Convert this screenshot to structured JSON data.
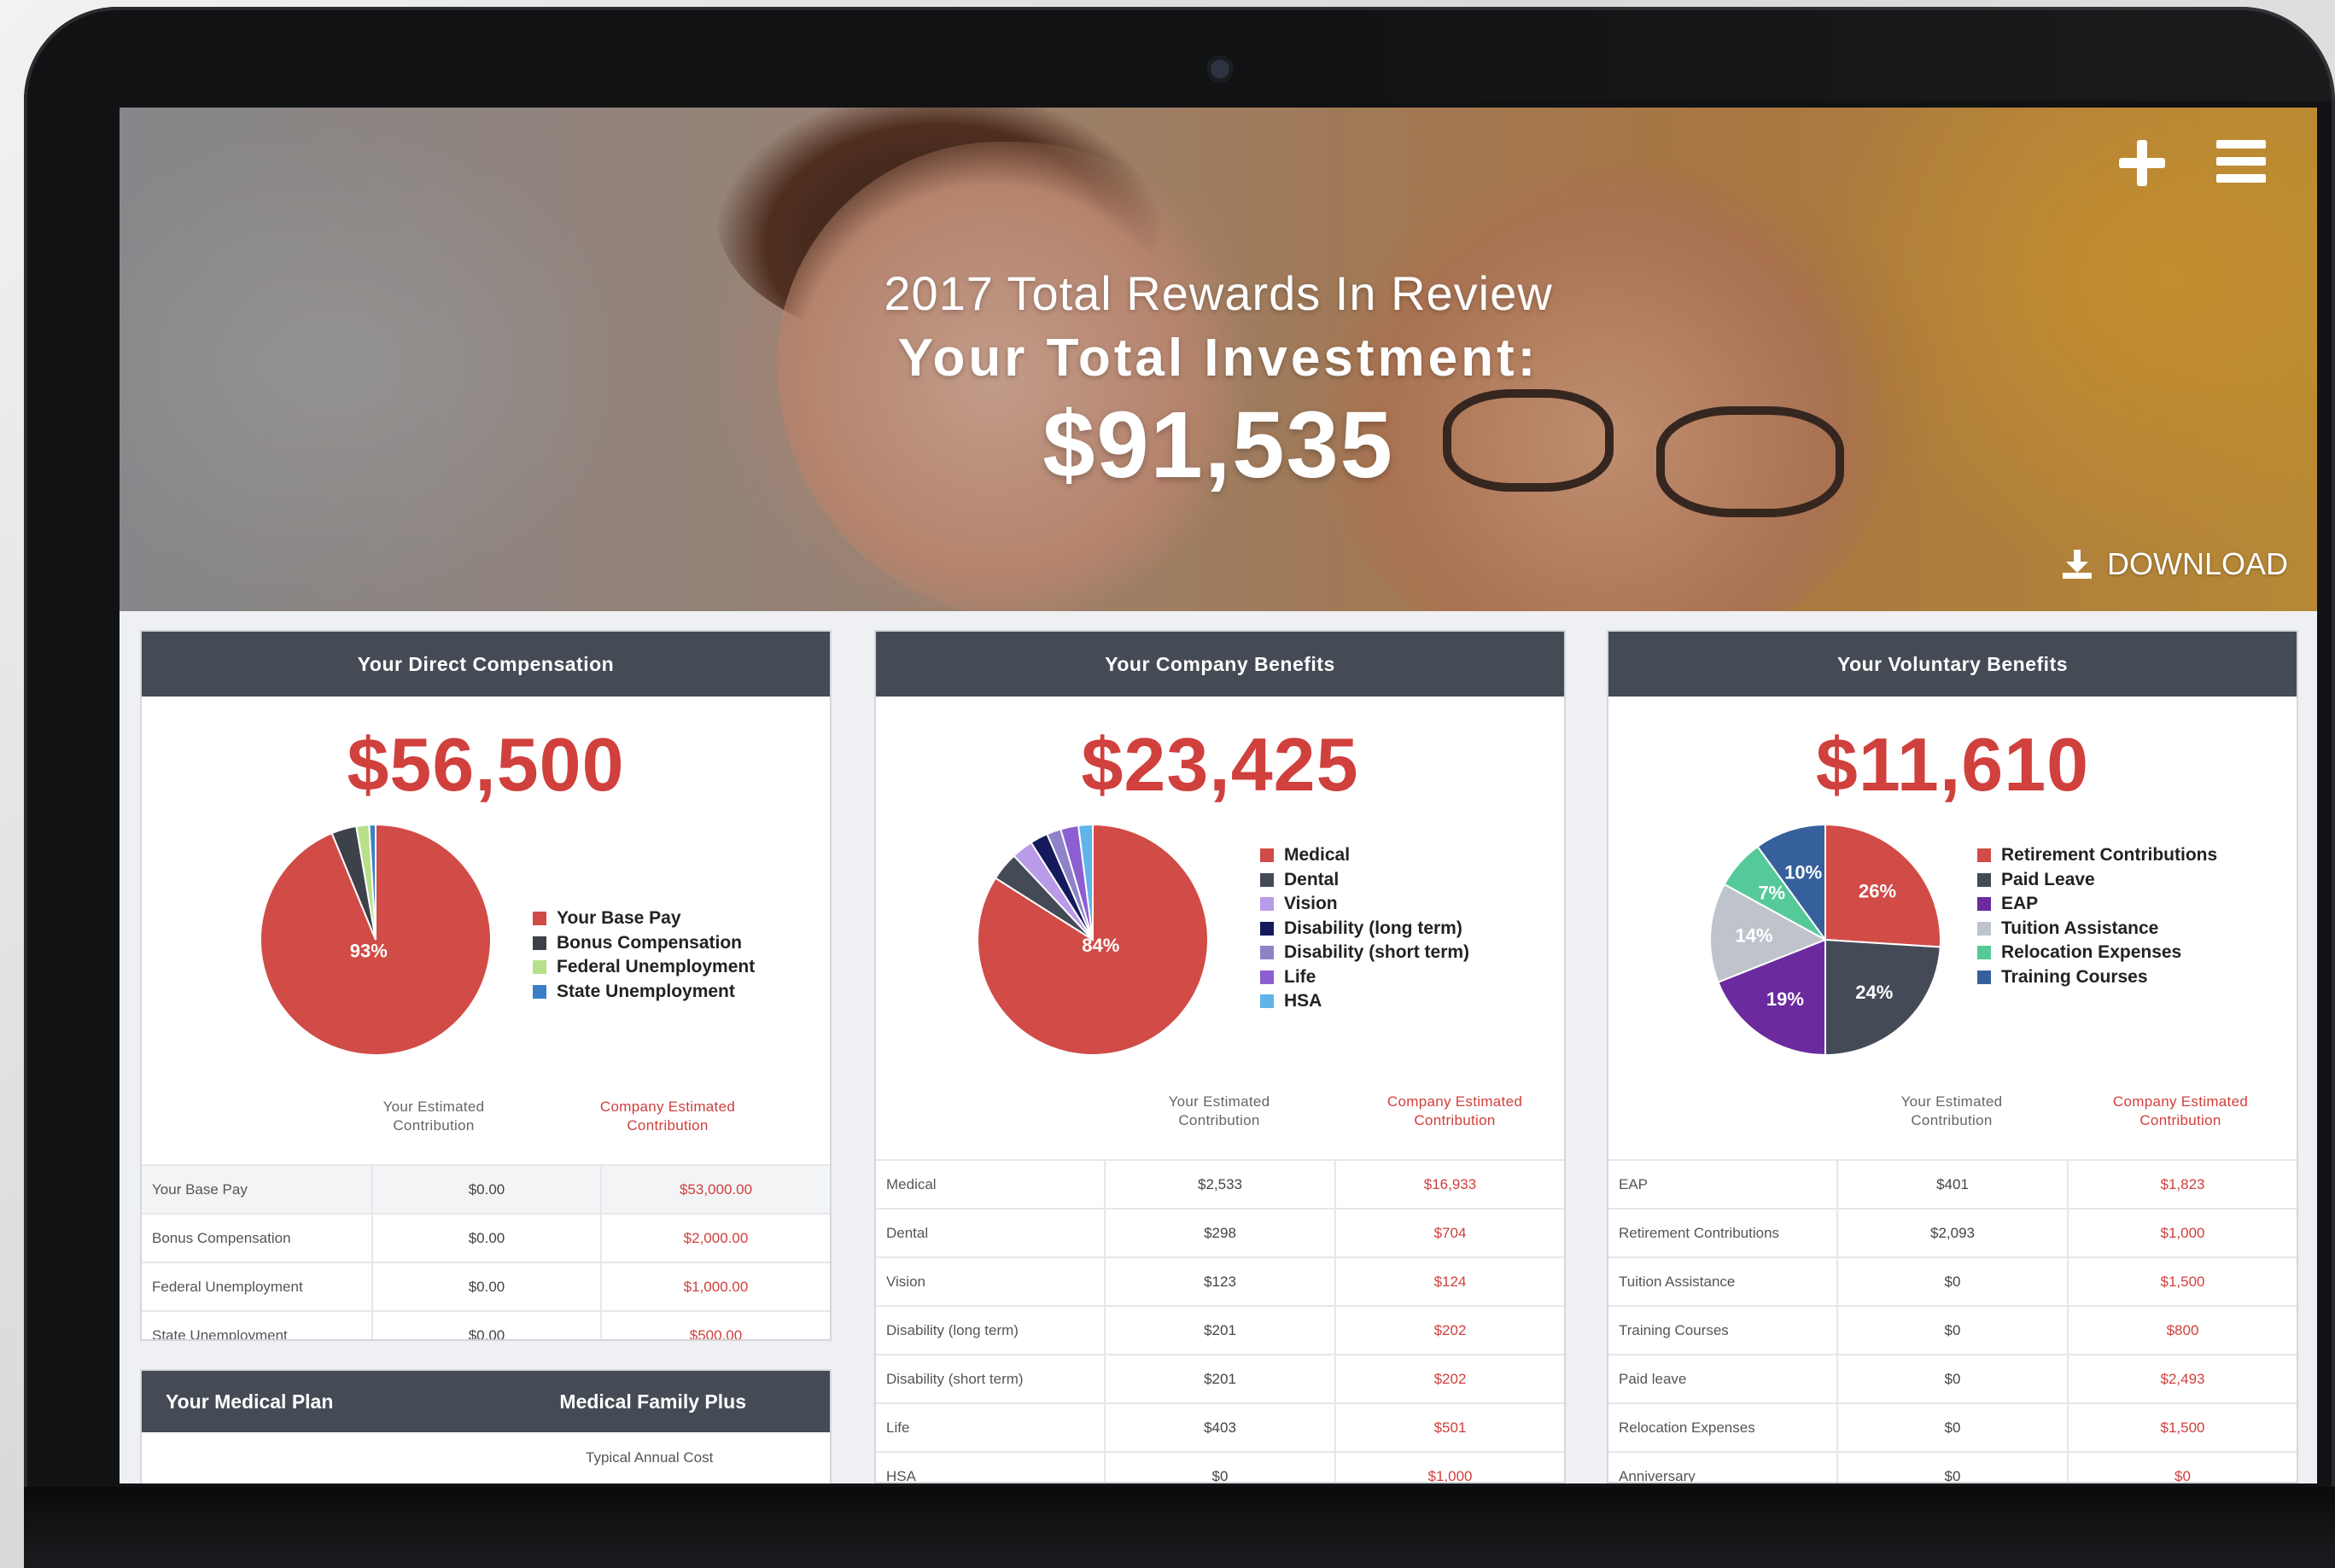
{
  "hero": {
    "subtitle": "2017 Total Rewards In Review",
    "title": "Your Total Investment:",
    "total": "$91,535",
    "download_label": "DOWNLOAD"
  },
  "icons": {
    "add": "plus-icon",
    "menu": "hamburger-menu-icon",
    "download": "download-icon"
  },
  "colors": {
    "accent_red": "#d0403d",
    "header_slate": "#454b55"
  },
  "column_headers": {
    "yours_line1": "Your Estimated",
    "yours_line2": "Contribution",
    "company_line1": "Company Estimated",
    "company_line2": "Contribution"
  },
  "direct_compensation": {
    "title": "Your Direct Compensation",
    "total": "$56,500",
    "chart_data": {
      "type": "pie",
      "labels": [
        "Your Base Pay",
        "Bonus Compensation",
        "Federal Unemployment",
        "State Unemployment"
      ],
      "values": [
        93.8,
        3.5,
        1.8,
        0.9
      ],
      "colors": [
        "#d14b47",
        "#3d4149",
        "#b8e08a",
        "#3a80c8"
      ],
      "slice_labels": [
        "93%",
        "",
        "",
        ""
      ]
    },
    "rows": [
      {
        "label": "Your Base Pay",
        "yours": "$0.00",
        "company": "$53,000.00"
      },
      {
        "label": "Bonus Compensation",
        "yours": "$0.00",
        "company": "$2,000.00"
      },
      {
        "label": "Federal Unemployment",
        "yours": "$0.00",
        "company": "$1,000.00"
      },
      {
        "label": "State Unemployment",
        "yours": "$0.00",
        "company": "$500.00"
      }
    ]
  },
  "company_benefits": {
    "title": "Your Company Benefits",
    "total": "$23,425",
    "chart_data": {
      "type": "pie",
      "labels": [
        "Medical",
        "Dental",
        "Vision",
        "Disability (long term)",
        "Disability (short term)",
        "Life",
        "HSA"
      ],
      "values": [
        84,
        4,
        3,
        2.5,
        2,
        2.5,
        2
      ],
      "colors": [
        "#d14b47",
        "#444b57",
        "#b99be8",
        "#141a5c",
        "#8f83c8",
        "#8b5fd1",
        "#5fb4ea"
      ],
      "slice_labels": [
        "84%",
        "",
        "",
        "",
        "",
        "",
        ""
      ]
    },
    "rows": [
      {
        "label": "Medical",
        "yours": "$2,533",
        "company": "$16,933"
      },
      {
        "label": "Dental",
        "yours": "$298",
        "company": "$704"
      },
      {
        "label": "Vision",
        "yours": "$123",
        "company": "$124"
      },
      {
        "label": "Disability (long term)",
        "yours": "$201",
        "company": "$202"
      },
      {
        "label": "Disability (short term)",
        "yours": "$201",
        "company": "$202"
      },
      {
        "label": "Life",
        "yours": "$403",
        "company": "$501"
      },
      {
        "label": "HSA",
        "yours": "$0",
        "company": "$1,000"
      }
    ]
  },
  "voluntary_benefits": {
    "title": "Your Voluntary Benefits",
    "total": "$11,610",
    "chart_data": {
      "type": "pie",
      "labels": [
        "Retirement Contributions",
        "Paid Leave",
        "EAP",
        "Tuition Assistance",
        "Relocation Expenses",
        "Training Courses"
      ],
      "values": [
        26,
        24,
        19,
        14,
        7,
        10
      ],
      "colors": [
        "#d14b47",
        "#444b57",
        "#6b2a9e",
        "#bfc4cc",
        "#56c99a",
        "#36609c"
      ],
      "slice_labels": [
        "26%",
        "24%",
        "19%",
        "14%",
        "7%",
        "10%"
      ]
    },
    "rows": [
      {
        "label": "EAP",
        "yours": "$401",
        "company": "$1,823"
      },
      {
        "label": "Retirement Contributions",
        "yours": "$2,093",
        "company": "$1,000"
      },
      {
        "label": "Tuition Assistance",
        "yours": "$0",
        "company": "$1,500"
      },
      {
        "label": "Training Courses",
        "yours": "$0",
        "company": "$800"
      },
      {
        "label": "Paid leave",
        "yours": "$0",
        "company": "$2,493"
      },
      {
        "label": "Relocation Expenses",
        "yours": "$0",
        "company": "$1,500"
      },
      {
        "label": "Anniversary",
        "yours": "$0",
        "company": "$0"
      }
    ]
  },
  "medical_plan": {
    "title": "Your Medical Plan",
    "plan_name": "Medical Family Plus",
    "subheading": "Typical Annual Cost"
  }
}
